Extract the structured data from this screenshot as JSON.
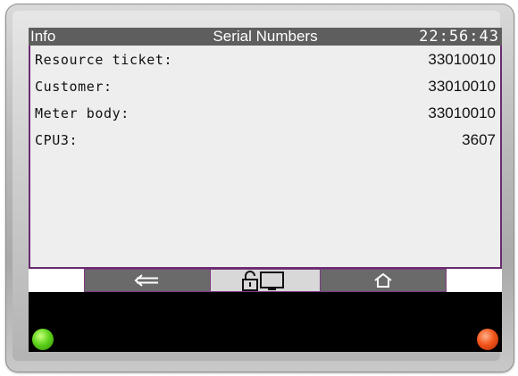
{
  "header": {
    "left_label": "Info",
    "title": "Serial Numbers",
    "time": "22:56:43"
  },
  "rows": [
    {
      "label": "Resource ticket:",
      "value": "33010010"
    },
    {
      "label": "Customer:",
      "value": "33010010"
    },
    {
      "label": "Meter body:",
      "value": "33010010"
    },
    {
      "label": "CPU3:",
      "value": "3607"
    }
  ],
  "navbar": {
    "buttons": [
      {
        "icon": "back-arrow-icon",
        "state": "normal"
      },
      {
        "icon": "unlock-display-icon",
        "state": "active"
      },
      {
        "icon": "home-icon",
        "state": "normal"
      }
    ]
  },
  "indicators": {
    "left_led_color": "#5fd21c",
    "right_led_color": "#f2561b"
  },
  "colors": {
    "header_bg": "#5e5e5e",
    "content_bg": "#eeeeee",
    "border_accent": "#6a2b6f"
  }
}
